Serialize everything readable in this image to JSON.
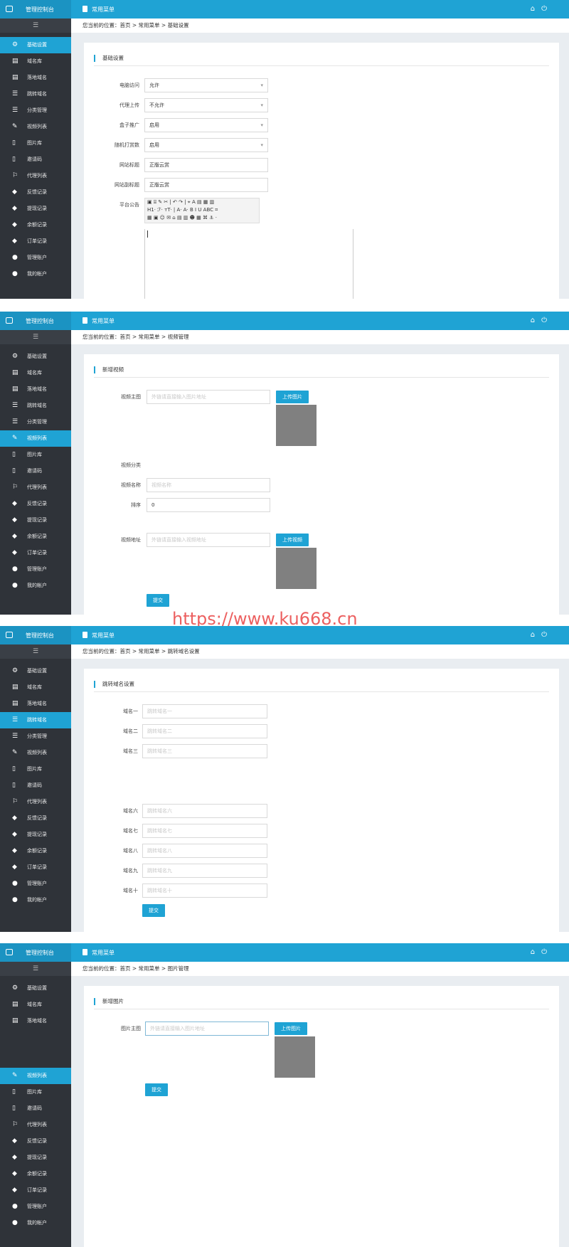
{
  "topbar": {
    "app_title": "管理控制台",
    "menu_label": "常用菜单",
    "right_icons": [
      "home-icon",
      "power-icon"
    ]
  },
  "sidebar_items": [
    "基础设置",
    "域名库",
    "落地域名",
    "跳转域名",
    "分类管理",
    "视频列表",
    "图片库",
    "邀请码",
    "代理列表",
    "反馈记录",
    "提现记录",
    "余额记录",
    "订单记录",
    "管理账户",
    "我的帐户"
  ],
  "screens": [
    {
      "breadcrumb": "您当前的位置：首页 > 常用菜单 > 基础设置",
      "active_item": "基础设置",
      "card_title": "基础设置",
      "fields": [
        {
          "label": "电脑访问",
          "value": "允许",
          "type": "select"
        },
        {
          "label": "代理上传",
          "value": "不允许",
          "type": "select"
        },
        {
          "label": "盒子推广",
          "value": "启用",
          "type": "select"
        },
        {
          "label": "随机打赏数",
          "value": "启用",
          "type": "select"
        },
        {
          "label": "网站标题",
          "value": "正版云赏",
          "type": "text"
        },
        {
          "label": "网站副标题",
          "value": "正版云赏",
          "type": "text"
        }
      ],
      "editor_label": "平台公告",
      "editor_toolbar": [
        "▣ ⌸ ✎ ✂ | ↶ ↷ | ⌖ A ▤ ▦ ▥",
        "H1· ℱ· тT· | A· A· B I U ABC ⌗",
        "▦ ▣ ☺ ✉ ⌂ ▤ ▥ ☻ ▦ ⌘ ⚓ ·"
      ]
    },
    {
      "breadcrumb": "您当前的位置：首页 > 常用菜单 > 视频管理",
      "active_item": "视频列表",
      "card_title": "新增视频",
      "main_image_label": "视频主图",
      "main_image_placeholder": "外链请直接输入图片地址",
      "upload_image_label": "上传图片",
      "category_label": "视频分类",
      "name_label": "视频名称",
      "name_placeholder": "视频名称",
      "order_label": "排序",
      "order_value": "0",
      "url_label": "视频地址",
      "url_placeholder": "外链请直接输入视频地址",
      "upload_video_label": "上传视频",
      "submit_label": "提交"
    },
    {
      "breadcrumb": "您当前的位置：首页 > 常用菜单 > 跳转域名设置",
      "active_item": "跳转域名",
      "card_title": "跳转域名设置",
      "fields": [
        {
          "label": "域名一",
          "placeholder": "跳转域名一"
        },
        {
          "label": "域名二",
          "placeholder": "跳转域名二"
        },
        {
          "label": "域名三",
          "placeholder": "跳转域名三"
        },
        {
          "label": "域名六",
          "placeholder": "跳转域名六"
        },
        {
          "label": "域名七",
          "placeholder": "跳转域名七"
        },
        {
          "label": "域名八",
          "placeholder": "跳转域名八"
        },
        {
          "label": "域名九",
          "placeholder": "跳转域名九"
        },
        {
          "label": "域名十",
          "placeholder": "跳转域名十"
        }
      ],
      "submit_label": "提交"
    },
    {
      "breadcrumb": "您当前的位置：首页 > 常用菜单 > 图片管理",
      "active_item": "视频列表",
      "card_title": "新增图片",
      "main_image_label": "图片主图",
      "main_image_placeholder": "外链请直接输入图片地址",
      "upload_image_label": "上传图片",
      "submit_label": "提交",
      "sidebar_visible": [
        "基础设置",
        "域名库",
        "落地域名",
        "视频列表",
        "图片库",
        "邀请码",
        "代理列表",
        "反馈记录",
        "提现记录",
        "余额记录",
        "订单记录",
        "管理账户",
        "我的帐户"
      ]
    }
  ],
  "watermark": "https://www.ku668.cn"
}
